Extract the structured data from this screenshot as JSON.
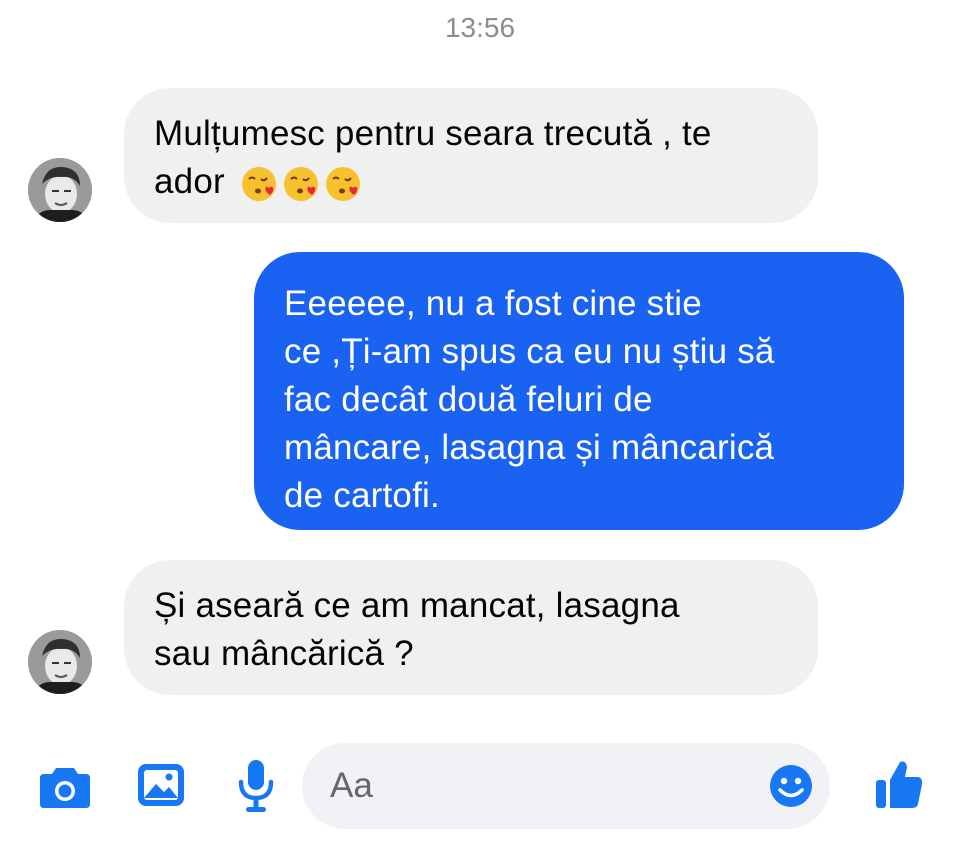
{
  "chat": {
    "timestamp": "13:56",
    "messages": [
      {
        "direction": "incoming",
        "lines": [
          "Mulțumesc pentru seara trecută , te",
          "ador"
        ],
        "emojis": [
          "kissing-face-with-heart",
          "kissing-face-with-heart",
          "kissing-face-with-heart"
        ]
      },
      {
        "direction": "outgoing",
        "lines": [
          "Eeeeee, nu a fost cine stie",
          "ce ,Ți-am spus ca eu nu știu să",
          "fac decât două feluri de",
          "mâncare, lasagna și mâncarică",
          "de cartofi."
        ]
      },
      {
        "direction": "incoming",
        "lines": [
          "Și aseară ce am mancat, lasagna",
          "sau mâncărică ?"
        ]
      }
    ]
  },
  "composer": {
    "placeholder": "Aa",
    "icons": [
      "camera-icon",
      "gallery-icon",
      "microphone-icon",
      "emoji-icon",
      "thumbs-up-icon"
    ]
  },
  "colors": {
    "accent": "#1877f2",
    "outgoing_bubble": "#1a62f2",
    "incoming_bubble": "#f0f0f0",
    "timestamp": "#8a8d91",
    "input_background": "#f0f2f5"
  }
}
